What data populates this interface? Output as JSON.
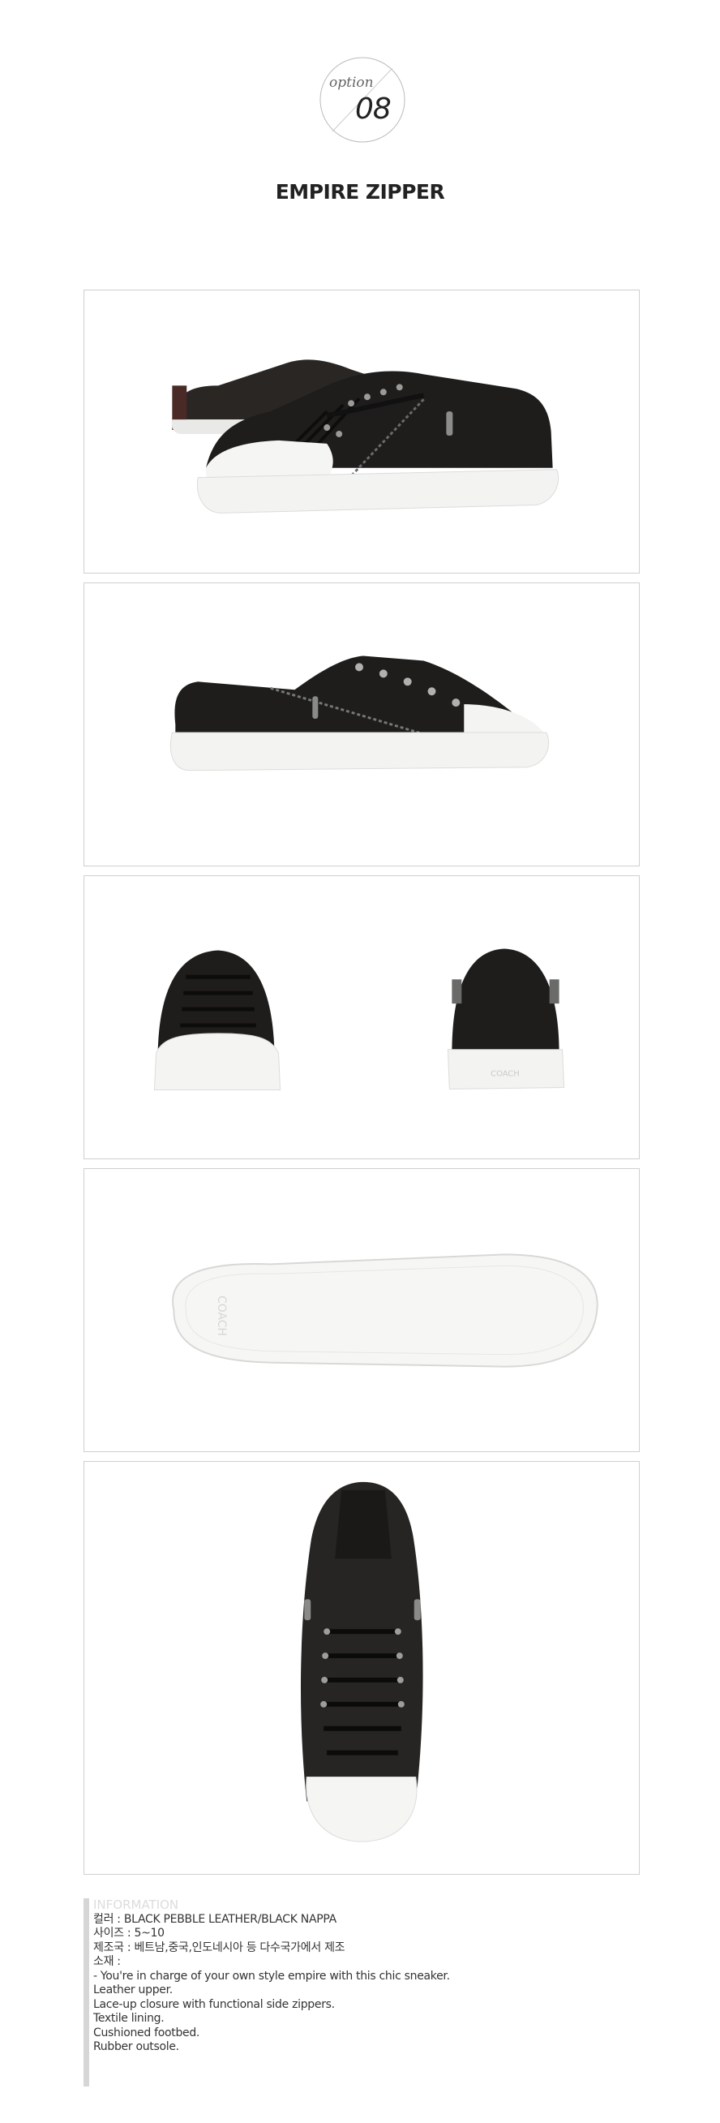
{
  "badge": {
    "label": "option",
    "number": "08"
  },
  "title": "EMPIRE ZIPPER",
  "photos": [
    {
      "alt": "pair-three-quarter-view"
    },
    {
      "alt": "side-profile-view"
    },
    {
      "alt": "front-and-back-views"
    },
    {
      "alt": "outsole-view"
    },
    {
      "alt": "top-down-view"
    }
  ],
  "sole_brand": "COACH",
  "info": {
    "heading": "INFORMATION",
    "color": "컬러 : BLACK PEBBLE LEATHER/BLACK NAPPA",
    "size": "사이즈 :  5~10",
    "origin": "제조국 :  베트남,중국,인도네시아 등 다수국가에서 제조",
    "material": "소재 :",
    "details": [
      "- You're in charge of your own style empire with this chic sneaker.",
      "Leather upper.",
      "Lace-up closure with functional side zippers.",
      "Textile lining.",
      "Cushioned footbed.",
      "Rubber outsole."
    ]
  },
  "colors": {
    "shoe": "#1e1d1c",
    "sole": "#f3f3f1",
    "frame_border": "#cfcfcf"
  }
}
